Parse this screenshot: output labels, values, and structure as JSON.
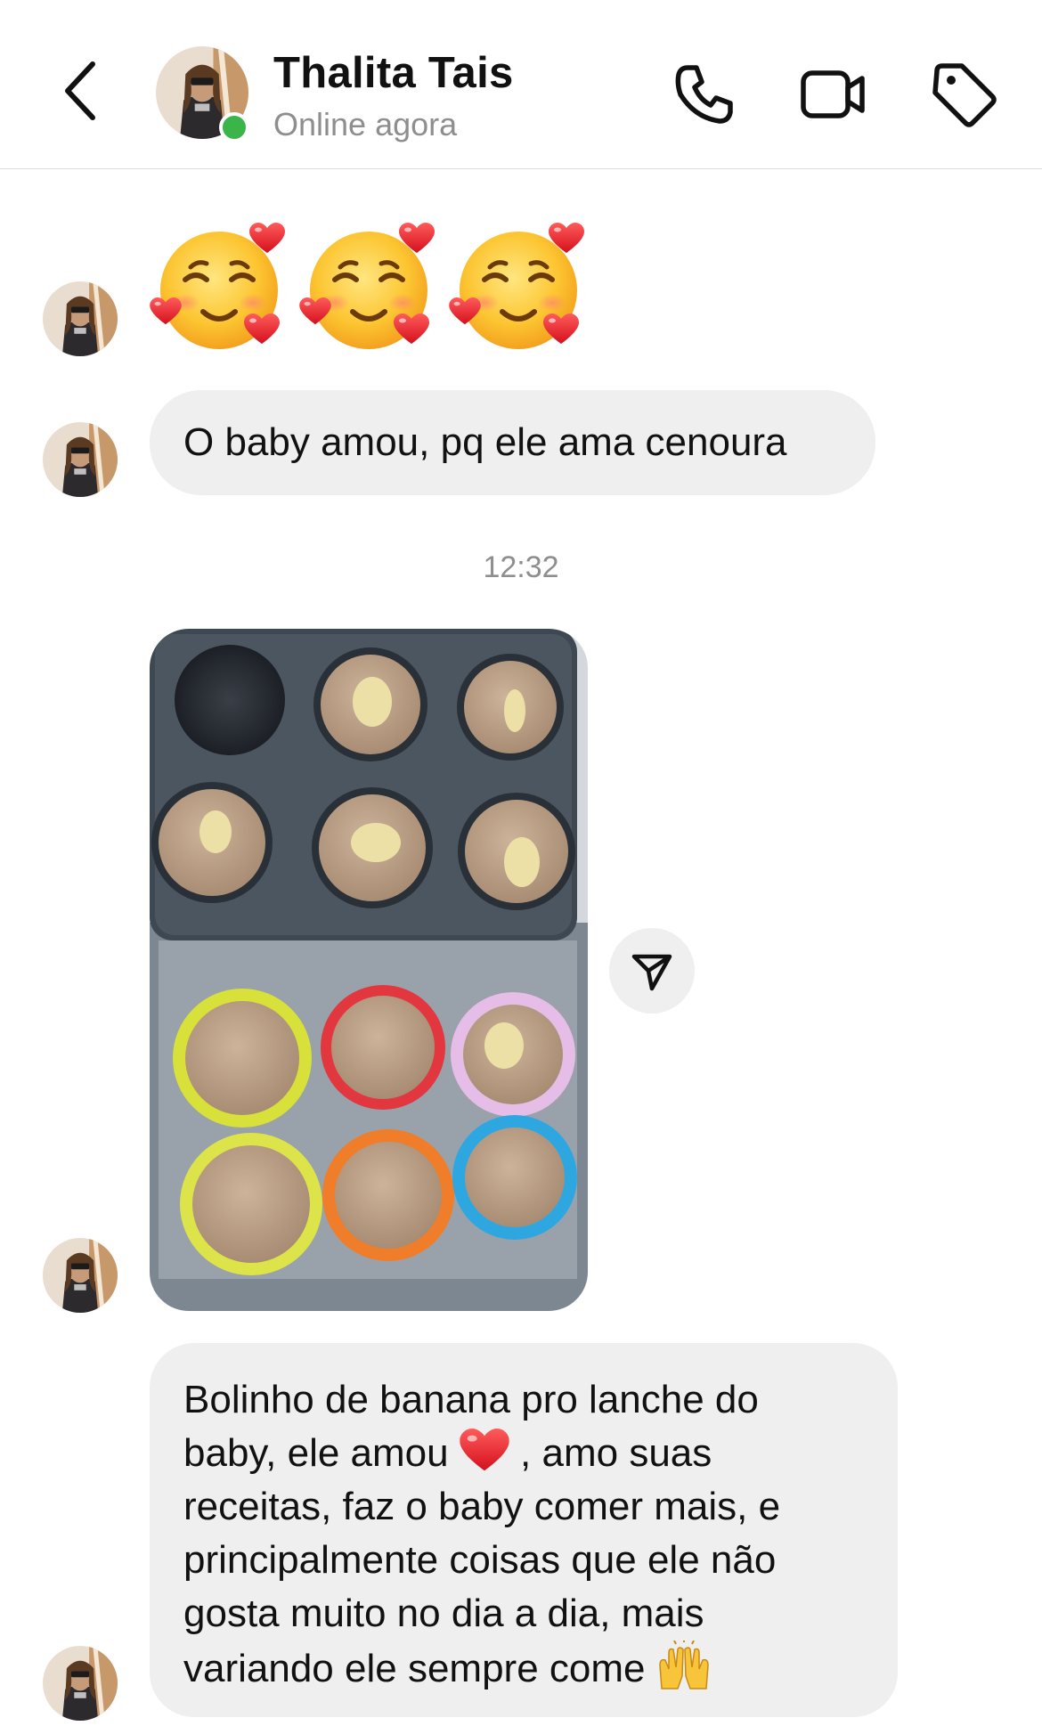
{
  "header": {
    "contact_name": "Thalita Tais",
    "status": "Online agora",
    "online_color": "#3bb54a",
    "icons": [
      "back-chevron-icon",
      "phone-icon",
      "video-camera-icon",
      "tag-icon"
    ]
  },
  "messages": {
    "emoji_row": [
      "smiling-face-with-hearts-emoji",
      "smiling-face-with-hearts-emoji",
      "smiling-face-with-hearts-emoji"
    ],
    "text_1": "O baby amou, pq ele ama cenoura",
    "timestamp": "12:32",
    "photo_description_icon": "muffin-tray-photo",
    "text_2_lines": {
      "l1": "Bolinho de banana pro lanche do",
      "l2a": "baby, ele amou ",
      "l2b": " , amo suas",
      "l3": "receitas, faz o baby comer mais,  e",
      "l4": "principalmente coisas que ele não",
      "l5": "gosta muito no dia a dia, mais",
      "l6": "variando ele sempre come "
    }
  },
  "colors": {
    "bubble_bg": "#efefef",
    "meta_text": "#8e8e8e",
    "divider": "#dcdcdc"
  }
}
